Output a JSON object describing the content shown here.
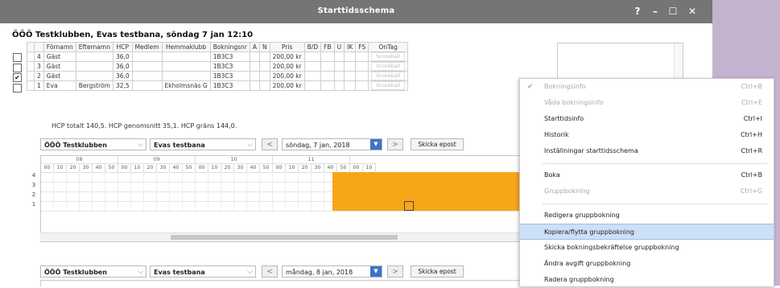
{
  "window": {
    "title": "Starttidsschema",
    "help": "?",
    "minimize": "–",
    "maximize": "☐",
    "close": "✕"
  },
  "header": "ÖÖÖ Testklubben, Evas testbana, söndag 7 jan 12:10",
  "bookings": {
    "columns": [
      "",
      "",
      "Förnamn",
      "Efternamn",
      "HCP",
      "Medlem",
      "Hemmaklubb",
      "Bokningsnr",
      "A",
      "N",
      "Pris",
      "B/D",
      "FB",
      "U",
      "IK",
      "FS",
      "OnTag"
    ],
    "rows": [
      {
        "checked": false,
        "num": "4",
        "first": "Gäst",
        "last": "",
        "hcp": "36,0",
        "club": "",
        "bookno": "1B3C3",
        "price": "200,00 kr",
        "ontag": "Scoreball"
      },
      {
        "checked": false,
        "num": "3",
        "first": "Gäst",
        "last": "",
        "hcp": "36,0",
        "club": "",
        "bookno": "1B3C3",
        "price": "200,00 kr",
        "ontag": "Scoreball"
      },
      {
        "checked": true,
        "num": "2",
        "first": "Gäst",
        "last": "",
        "hcp": "36,0",
        "club": "",
        "bookno": "1B3C3",
        "price": "200,00 kr",
        "ontag": "Scoreball"
      },
      {
        "checked": false,
        "num": "1",
        "first": "Eva",
        "last": "Bergström",
        "hcp": "32,5",
        "club": "Ekholmsnäs G",
        "bookno": "1B3C3",
        "price": "200,00 kr",
        "ontag": "Scoreball"
      }
    ]
  },
  "hcp_summary": "HCP totalt 140,5.  HCP genomsnitt 35,1.  HCP gräns 144,0.",
  "toolbar1": {
    "club": "ÖÖÖ Testklubben",
    "course": "Evas testbana",
    "prev": "<",
    "date": "söndag, 7 jan, 2018",
    "next": ">",
    "email": "Skicka epost"
  },
  "grid": {
    "hours": [
      "08",
      "09",
      "10",
      "11"
    ],
    "minutes": [
      "00",
      "10",
      "20",
      "30",
      "40",
      "50",
      "00",
      "10",
      "20",
      "30",
      "40",
      "50",
      "00",
      "10",
      "20",
      "30",
      "40",
      "50",
      "00",
      "10",
      "20",
      "30",
      "40",
      "50",
      "00",
      "10"
    ],
    "rows": [
      "4",
      "3",
      "2",
      "1"
    ],
    "scroll_left": "<"
  },
  "toolbar2": {
    "club": "ÖÖÖ Testklubben",
    "course": "Evas testbana",
    "prev": "<",
    "date": "måndag, 8 jan, 2018",
    "next": ">",
    "email": "Skicka epost"
  },
  "context_menu": [
    {
      "label": "Bokningsinfo",
      "shortcut": "Ctrl+B",
      "enabled": false,
      "checked": true
    },
    {
      "label": "Våda bokningsinfo",
      "shortcut": "Ctrl+E",
      "enabled": false
    },
    {
      "label": "Starttidsinfo",
      "shortcut": "Ctrl+I",
      "enabled": true
    },
    {
      "label": "Historik",
      "shortcut": "Ctrl+H",
      "enabled": true
    },
    {
      "label": "Inställningar starttidsschema",
      "shortcut": "Ctrl+R",
      "enabled": true
    },
    {
      "label": "Boka",
      "shortcut": "Ctrl+B",
      "enabled": true
    },
    {
      "label": "Gruppbokning",
      "shortcut": "Ctrl+G",
      "enabled": false
    },
    {
      "label": "Redigera gruppbokning",
      "shortcut": "",
      "enabled": true
    },
    {
      "label": "Kopiera/flytta gruppbokning",
      "shortcut": "",
      "enabled": true,
      "highlighted": true
    },
    {
      "label": "Skicka bokningsbekräftelse gruppbokning",
      "shortcut": "",
      "enabled": true
    },
    {
      "label": "Ändra avgift gruppbokning",
      "shortcut": "",
      "enabled": true
    },
    {
      "label": "Radera gruppbokning",
      "shortcut": "",
      "enabled": true
    }
  ],
  "colors": {
    "titlebar": "#757575",
    "orange": "#f7a619",
    "highlight": "#cde0f7",
    "purple": "#c4b3cf"
  }
}
